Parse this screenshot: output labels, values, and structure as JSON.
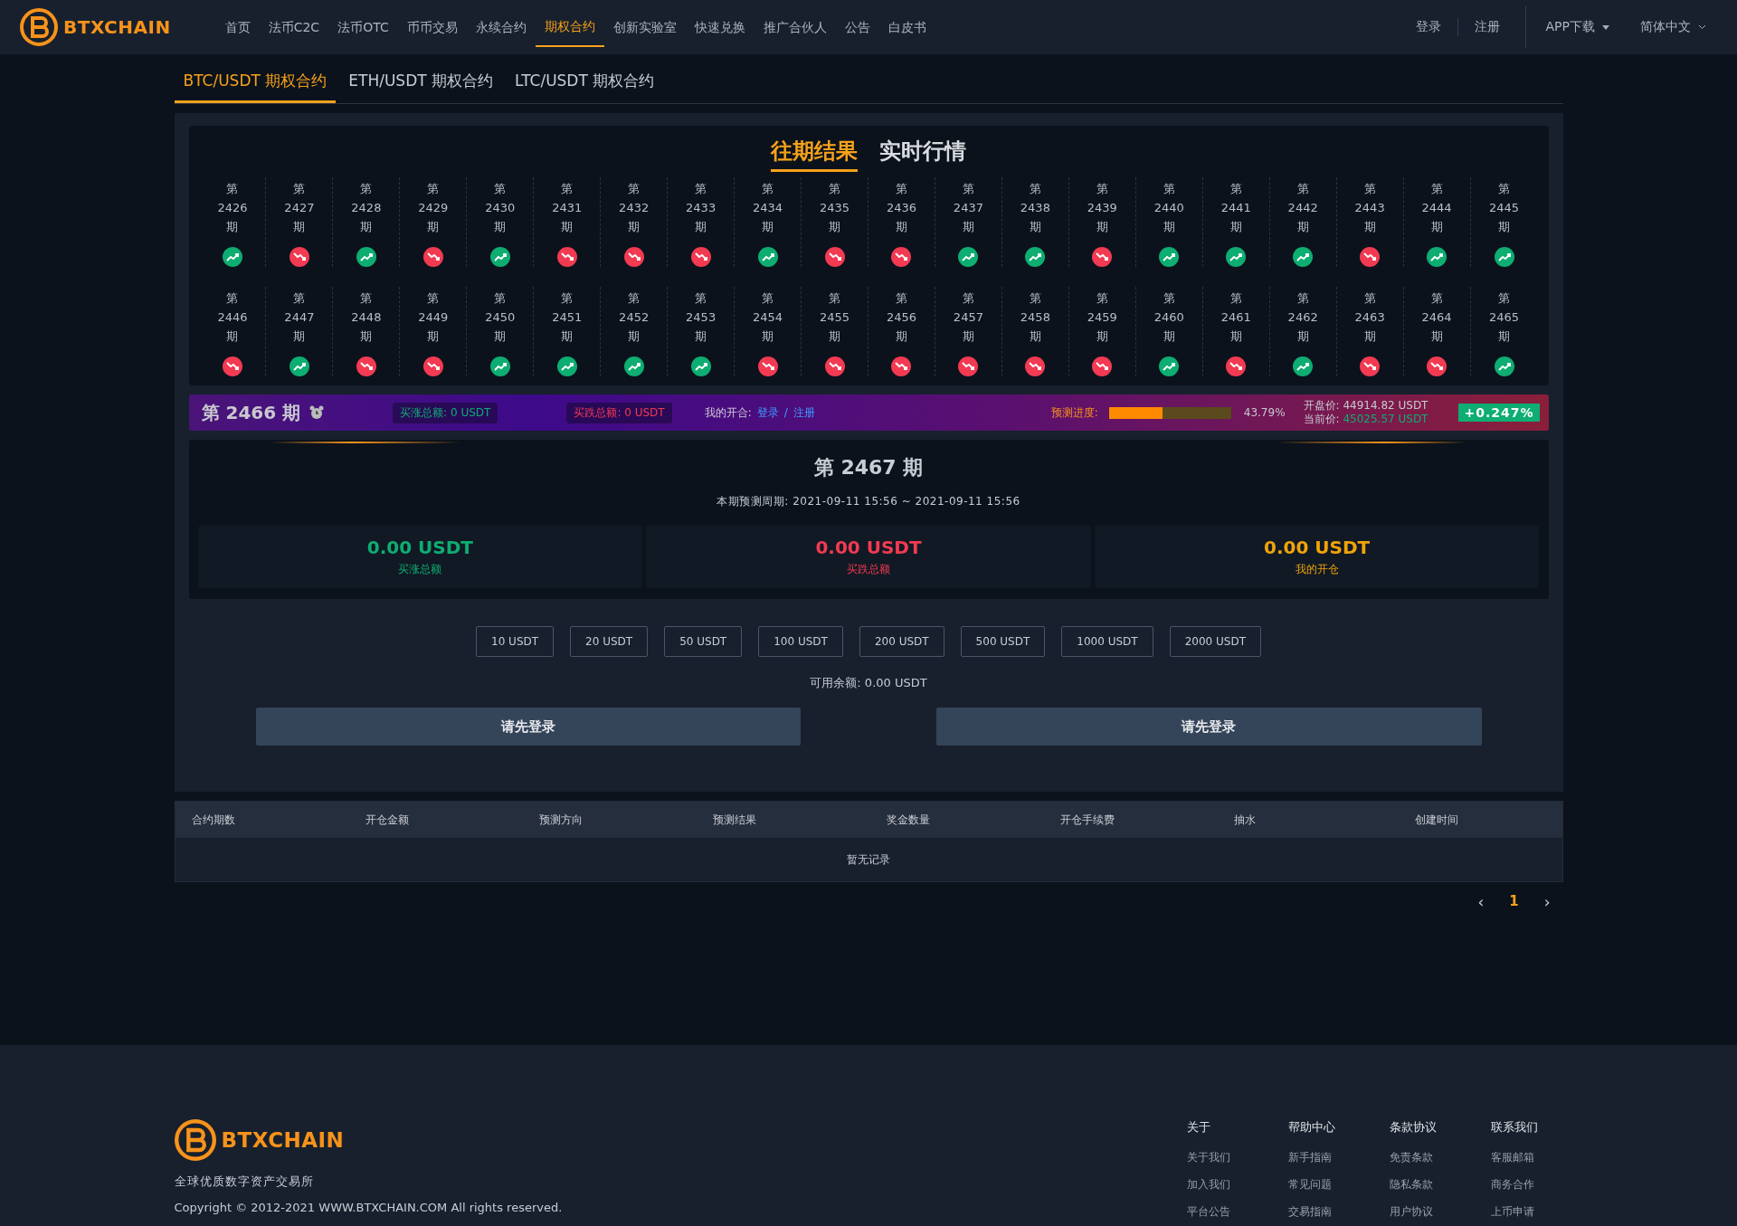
{
  "header": {
    "brand": "BTXCHAIN",
    "nav": [
      {
        "label": "首页",
        "selected": false
      },
      {
        "label": "法币C2C",
        "selected": false
      },
      {
        "label": "法币OTC",
        "selected": false
      },
      {
        "label": "币币交易",
        "selected": false
      },
      {
        "label": "永续合约",
        "selected": false
      },
      {
        "label": "期权合约",
        "selected": true
      },
      {
        "label": "创新实验室",
        "selected": false
      },
      {
        "label": "快速兑换",
        "selected": false
      },
      {
        "label": "推广合伙人",
        "selected": false
      },
      {
        "label": "公告",
        "selected": false
      },
      {
        "label": "白皮书",
        "selected": false
      }
    ],
    "login": "登录",
    "register": "注册",
    "app_download": "APP下载",
    "language": "简体中文"
  },
  "market_tabs": [
    {
      "label": "BTC/USDT 期权合约",
      "selected": true
    },
    {
      "label": "ETH/USDT 期权合约",
      "selected": false
    },
    {
      "label": "LTC/USDT 期权合约",
      "selected": false
    }
  ],
  "result_tabs": [
    {
      "label": "往期结果",
      "selected": true
    },
    {
      "label": "实时行情",
      "selected": false
    }
  ],
  "periods": [
    [
      {
        "pre": "第",
        "num": "2426",
        "post": "期",
        "kind": "up"
      },
      {
        "pre": "第",
        "num": "2427",
        "post": "期",
        "kind": "down"
      },
      {
        "pre": "第",
        "num": "2428",
        "post": "期",
        "kind": "up"
      },
      {
        "pre": "第",
        "num": "2429",
        "post": "期",
        "kind": "down"
      },
      {
        "pre": "第",
        "num": "2430",
        "post": "期",
        "kind": "up"
      },
      {
        "pre": "第",
        "num": "2431",
        "post": "期",
        "kind": "down"
      },
      {
        "pre": "第",
        "num": "2432",
        "post": "期",
        "kind": "down"
      },
      {
        "pre": "第",
        "num": "2433",
        "post": "期",
        "kind": "down"
      },
      {
        "pre": "第",
        "num": "2434",
        "post": "期",
        "kind": "up"
      },
      {
        "pre": "第",
        "num": "2435",
        "post": "期",
        "kind": "down"
      },
      {
        "pre": "第",
        "num": "2436",
        "post": "期",
        "kind": "down"
      },
      {
        "pre": "第",
        "num": "2437",
        "post": "期",
        "kind": "up"
      },
      {
        "pre": "第",
        "num": "2438",
        "post": "期",
        "kind": "up"
      },
      {
        "pre": "第",
        "num": "2439",
        "post": "期",
        "kind": "down"
      },
      {
        "pre": "第",
        "num": "2440",
        "post": "期",
        "kind": "up"
      },
      {
        "pre": "第",
        "num": "2441",
        "post": "期",
        "kind": "up"
      },
      {
        "pre": "第",
        "num": "2442",
        "post": "期",
        "kind": "up"
      },
      {
        "pre": "第",
        "num": "2443",
        "post": "期",
        "kind": "down"
      },
      {
        "pre": "第",
        "num": "2444",
        "post": "期",
        "kind": "up"
      },
      {
        "pre": "第",
        "num": "2445",
        "post": "期",
        "kind": "up"
      }
    ],
    [
      {
        "pre": "第",
        "num": "2446",
        "post": "期",
        "kind": "down"
      },
      {
        "pre": "第",
        "num": "2447",
        "post": "期",
        "kind": "up"
      },
      {
        "pre": "第",
        "num": "2448",
        "post": "期",
        "kind": "down"
      },
      {
        "pre": "第",
        "num": "2449",
        "post": "期",
        "kind": "down"
      },
      {
        "pre": "第",
        "num": "2450",
        "post": "期",
        "kind": "up"
      },
      {
        "pre": "第",
        "num": "2451",
        "post": "期",
        "kind": "up"
      },
      {
        "pre": "第",
        "num": "2452",
        "post": "期",
        "kind": "up"
      },
      {
        "pre": "第",
        "num": "2453",
        "post": "期",
        "kind": "up"
      },
      {
        "pre": "第",
        "num": "2454",
        "post": "期",
        "kind": "down"
      },
      {
        "pre": "第",
        "num": "2455",
        "post": "期",
        "kind": "down"
      },
      {
        "pre": "第",
        "num": "2456",
        "post": "期",
        "kind": "down"
      },
      {
        "pre": "第",
        "num": "2457",
        "post": "期",
        "kind": "down"
      },
      {
        "pre": "第",
        "num": "2458",
        "post": "期",
        "kind": "down"
      },
      {
        "pre": "第",
        "num": "2459",
        "post": "期",
        "kind": "down"
      },
      {
        "pre": "第",
        "num": "2460",
        "post": "期",
        "kind": "up"
      },
      {
        "pre": "第",
        "num": "2461",
        "post": "期",
        "kind": "down"
      },
      {
        "pre": "第",
        "num": "2462",
        "post": "期",
        "kind": "up"
      },
      {
        "pre": "第",
        "num": "2463",
        "post": "期",
        "kind": "down"
      },
      {
        "pre": "第",
        "num": "2464",
        "post": "期",
        "kind": "down"
      },
      {
        "pre": "第",
        "num": "2465",
        "post": "期",
        "kind": "up"
      }
    ]
  ],
  "banner": {
    "current": "第 2466 期",
    "rise_label": "买涨总额:",
    "rise_value": "0 USDT",
    "fall_label": "买跌总额:",
    "fall_value": "0 USDT",
    "my_label": "我的开合:",
    "my_login": "登录",
    "my_sep": "/",
    "my_register": "注册",
    "progress_label": "预测进度:",
    "progress": {
      "level": 0.4379
    },
    "progress_text": "43.79%",
    "open_label": "开盘价:",
    "open_value": "44914.82 USDT",
    "now_label": "当前价:",
    "now_value": "45025.57 USDT",
    "change": "+0.247%"
  },
  "next": {
    "title": "第 2467 期",
    "cycle": "本期预测周期: 2021-09-11 15:56 ~ 2021-09-11 15:56"
  },
  "stats": [
    {
      "value": "0.00 USDT",
      "label": "买涨总额",
      "color": "#0ead72"
    },
    {
      "value": "0.00 USDT",
      "label": "买跌总额",
      "color": "#f23a52"
    },
    {
      "value": "0.00 USDT",
      "label": "我的开仓",
      "color": "#f0a30a"
    }
  ],
  "amounts": [
    "10 USDT",
    "20 USDT",
    "50 USDT",
    "100 USDT",
    "200 USDT",
    "500 USDT",
    "1000 USDT",
    "2000 USDT"
  ],
  "balance": "可用余额: 0.00 USDT",
  "actions": [
    "请先登录",
    "请先登录"
  ],
  "table": {
    "columns": [
      "合约期数",
      "开仓金额",
      "预测方向",
      "预测结果",
      "奖金数量",
      "开仓手续费",
      "抽水",
      "创建时间"
    ],
    "empty": "暂无记录"
  },
  "pagination": {
    "prev": "‹",
    "page": "1",
    "next": "›"
  },
  "footer": {
    "brand": "BTXCHAIN",
    "slogan": "全球优质数字资产交易所",
    "copyright": "Copyright © 2012-2021 WWW.BTXCHAIN.COM All rights reserved.",
    "columns": [
      {
        "title": "关于",
        "links": [
          "关于我们",
          "加入我们",
          "平台公告"
        ]
      },
      {
        "title": "帮助中心",
        "links": [
          "新手指南",
          "常见问题",
          "交易指南"
        ]
      },
      {
        "title": "条款协议",
        "links": [
          "免责条款",
          "隐私条款",
          "用户协议"
        ]
      },
      {
        "title": "联系我们",
        "links": [
          "客服邮箱",
          "商务合作",
          "上币申请"
        ]
      }
    ]
  }
}
